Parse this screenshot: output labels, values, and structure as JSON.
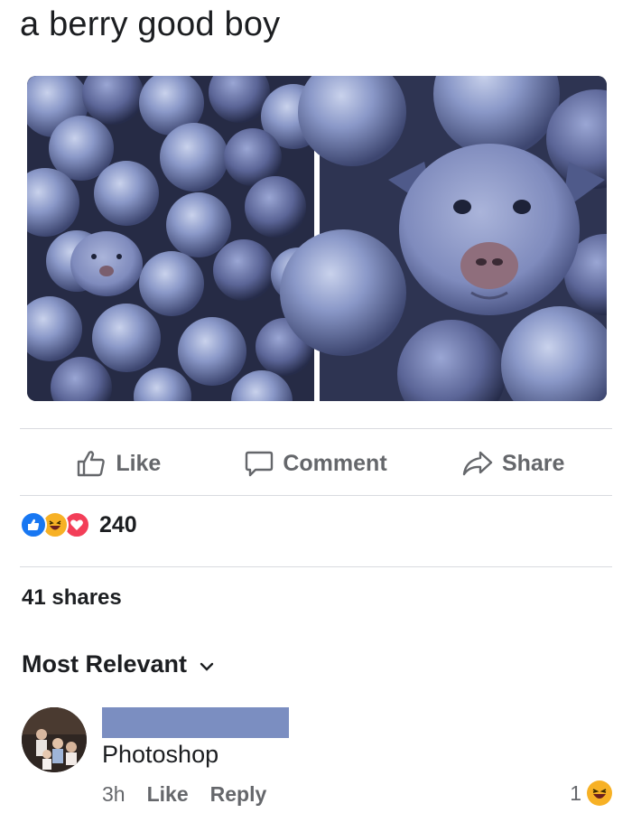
{
  "post": {
    "caption": "a berry good boy"
  },
  "actions": {
    "like_label": "Like",
    "comment_label": "Comment",
    "share_label": "Share"
  },
  "reactions": {
    "count": "240",
    "types": [
      "like",
      "haha",
      "love"
    ]
  },
  "shares": {
    "label": "41 shares"
  },
  "comments": {
    "sort_label": "Most Relevant",
    "items": [
      {
        "text": "Photoshop",
        "time": "3h",
        "like_label": "Like",
        "reply_label": "Reply",
        "reaction_count": "1",
        "reaction_type": "haha"
      }
    ]
  },
  "colors": {
    "redaction": "#7b8ec1",
    "like_blue": "#1877f2",
    "haha_yellow": "#f7b125",
    "love_red": "#f33e58"
  }
}
